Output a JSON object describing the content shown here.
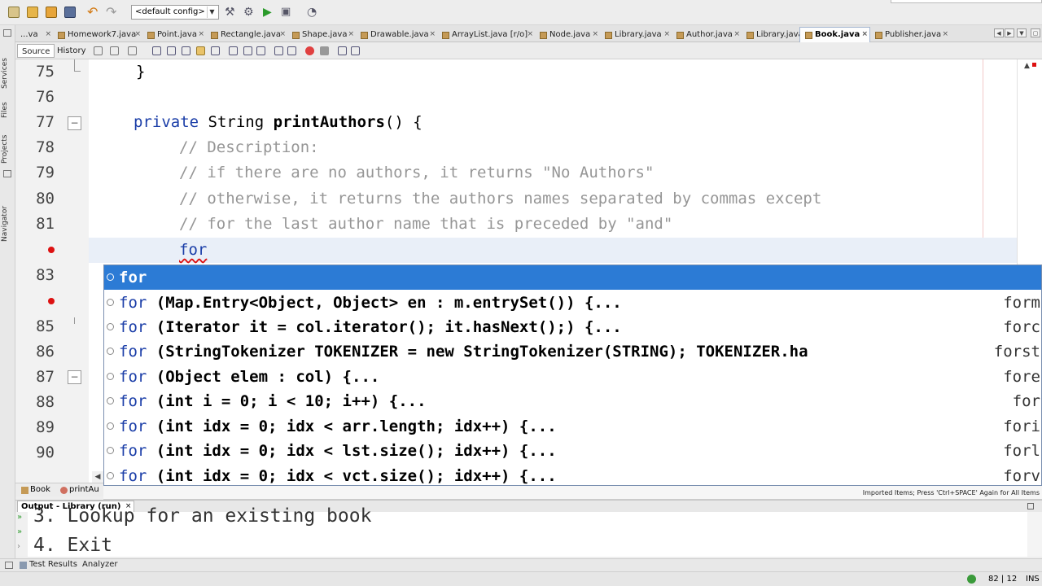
{
  "toolbar": {
    "config_value": "<default config>",
    "icons": [
      "new-file-icon",
      "new-project-icon",
      "open-project-icon",
      "save-all-icon",
      "undo-icon",
      "redo-icon",
      "build-icon",
      "clean-build-icon",
      "run-icon",
      "debug-icon",
      "profile-icon"
    ]
  },
  "side_panels": [
    "Services",
    "Files",
    "Projects",
    "Navigator"
  ],
  "tabs": [
    {
      "label": "...va"
    },
    {
      "label": "Homework7.java"
    },
    {
      "label": "Point.java"
    },
    {
      "label": "Rectangle.java"
    },
    {
      "label": "Shape.java"
    },
    {
      "label": "Drawable.java"
    },
    {
      "label": "ArrayList.java [r/o]"
    },
    {
      "label": "Node.java"
    },
    {
      "label": "Library.java"
    },
    {
      "label": "Author.java"
    },
    {
      "label": "Library.java"
    },
    {
      "label": "Book.java",
      "active": true
    },
    {
      "label": "Publisher.java"
    }
  ],
  "tab_close": "×",
  "editor_toolbar": {
    "source_label": "Source",
    "history_label": "History"
  },
  "editor": {
    "lines": [
      {
        "no": "75",
        "text": "}"
      },
      {
        "no": "76",
        "text": ""
      },
      {
        "no": "77",
        "kw": "private",
        "type": "String",
        "method": "printAuthors",
        "rest": "() {"
      },
      {
        "no": "78",
        "comment": "// Description:"
      },
      {
        "no": "79",
        "comment": "// if there are no authors, it returns \"No Authors\""
      },
      {
        "no": "80",
        "comment": "// otherwise, it returns the authors names separated by commas except"
      },
      {
        "no": "81",
        "comment": "// for the last author name that is preceded by \"and\""
      },
      {
        "no": "",
        "text": "for"
      },
      {
        "no": "83"
      },
      {
        "no": ""
      },
      {
        "no": "85"
      },
      {
        "no": "86"
      },
      {
        "no": "87"
      },
      {
        "no": "88"
      },
      {
        "no": "89"
      },
      {
        "no": "90"
      }
    ]
  },
  "completion": {
    "items": [
      {
        "head": "for",
        "code": "",
        "abbr": ""
      },
      {
        "head": "for",
        "code": "(Map.Entry<Object, Object> en : m.entrySet()) {...",
        "abbr": "form"
      },
      {
        "head": "for",
        "code": "(Iterator it = col.iterator(); it.hasNext();) {...",
        "abbr": "forc"
      },
      {
        "head": "for",
        "code": "(StringTokenizer TOKENIZER = new StringTokenizer(STRING); TOKENIZER.ha",
        "abbr": "forst"
      },
      {
        "head": "for",
        "code": "(Object elem : col) {...",
        "abbr": "fore"
      },
      {
        "head": "for",
        "code": "(int i = 0; i < 10; i++) {...",
        "abbr": "for"
      },
      {
        "head": "for",
        "code": "(int idx = 0; idx < arr.length; idx++) {...",
        "abbr": "fori"
      },
      {
        "head": "for",
        "code": "(int idx = 0; idx < lst.size(); idx++) {...",
        "abbr": "forl"
      },
      {
        "head": "for",
        "code": "(int idx = 0; idx < vct.size(); idx++) {...",
        "abbr": "forv"
      }
    ],
    "footer": "Imported Items; Press 'Ctrl+SPACE' Again for All Items"
  },
  "breadcrumbs": {
    "class_name": "Book",
    "method_name": "printAu"
  },
  "output": {
    "tab_label": "Output - Library (run)",
    "lines": [
      "3. Lookup for an existing book",
      "4. Exit"
    ]
  },
  "bottom_tabs": {
    "test_results": "Test Results",
    "analyzer": "Analyzer"
  },
  "status": {
    "position": "82 | 12",
    "mode": "INS"
  },
  "colors": {
    "keyword": "#1b3ea8",
    "comment": "#969696",
    "selection": "#2c7bd5",
    "error": "#dd1111"
  }
}
